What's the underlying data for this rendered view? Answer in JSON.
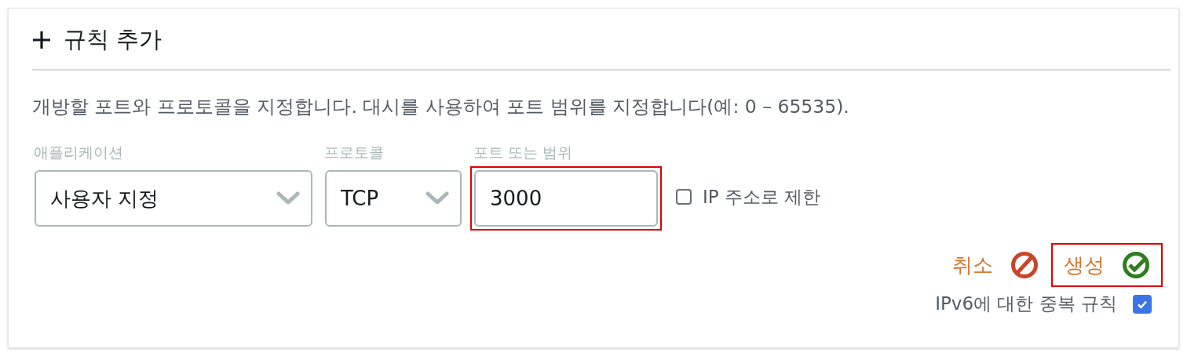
{
  "panel": {
    "title": "규칙 추가",
    "description": "개방할 포트와 프로토콜을 지정합니다. 대시를 사용하여 포트 범위를 지정합니다(예: 0 – 65535)."
  },
  "fields": [
    {
      "kind": "select",
      "label": "애플리케이션",
      "value": "사용자 지정",
      "highlighted": false
    },
    {
      "kind": "select",
      "label": "프로토콜",
      "value": "TCP",
      "highlighted": false
    },
    {
      "kind": "input",
      "label": "포트 또는 범위",
      "value": "3000",
      "highlighted": true
    }
  ],
  "restrict_ip": {
    "label": "IP 주소로 제한",
    "checked": false
  },
  "actions": [
    {
      "kind": "cancel",
      "label": "취소",
      "highlighted": false
    },
    {
      "kind": "create",
      "label": "생성",
      "highlighted": true
    }
  ],
  "ipv6_duplicate": {
    "label": "IPv6에 대한 중복 규칙",
    "checked": true
  }
}
